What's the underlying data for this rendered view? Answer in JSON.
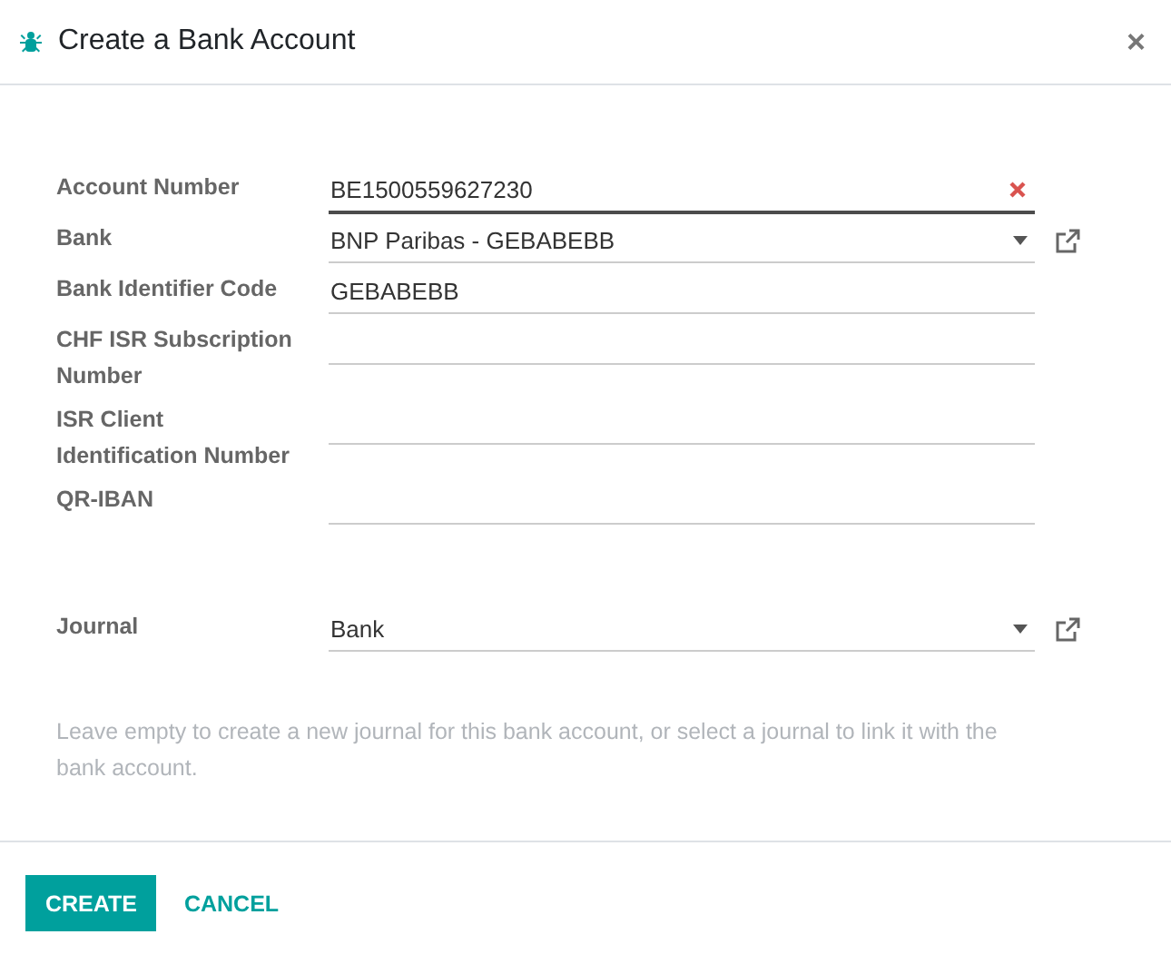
{
  "dialog": {
    "title": "Create a Bank Account",
    "close": "×"
  },
  "fields": [
    {
      "label": "Account Number",
      "value": "BE1500559627230",
      "kind": "text",
      "focused": true,
      "clearable": true
    },
    {
      "label": "Bank",
      "value": "BNP Paribas - GEBABEBB",
      "kind": "many2one",
      "focused": false,
      "clearable": false
    },
    {
      "label": "Bank Identifier Code",
      "value": "GEBABEBB",
      "kind": "text",
      "focused": false,
      "clearable": false
    },
    {
      "label": "CHF ISR Subscription Number",
      "kind": "text",
      "focused": false,
      "clearable": false
    },
    {
      "label": "ISR Client Identification Number",
      "kind": "text",
      "focused": false,
      "clearable": false
    },
    {
      "label": "QR-IBAN",
      "kind": "text",
      "focused": false,
      "clearable": false
    }
  ],
  "journal": {
    "label": "Journal",
    "value": "Bank",
    "kind": "many2one",
    "focused": false,
    "clearable": false
  },
  "help": "Leave empty to create a new journal for this bank account, or select a journal to link it with the bank account.",
  "buttons": [
    {
      "label": "CREATE",
      "kind": "primary"
    },
    {
      "label": "CANCEL",
      "kind": "link"
    }
  ]
}
